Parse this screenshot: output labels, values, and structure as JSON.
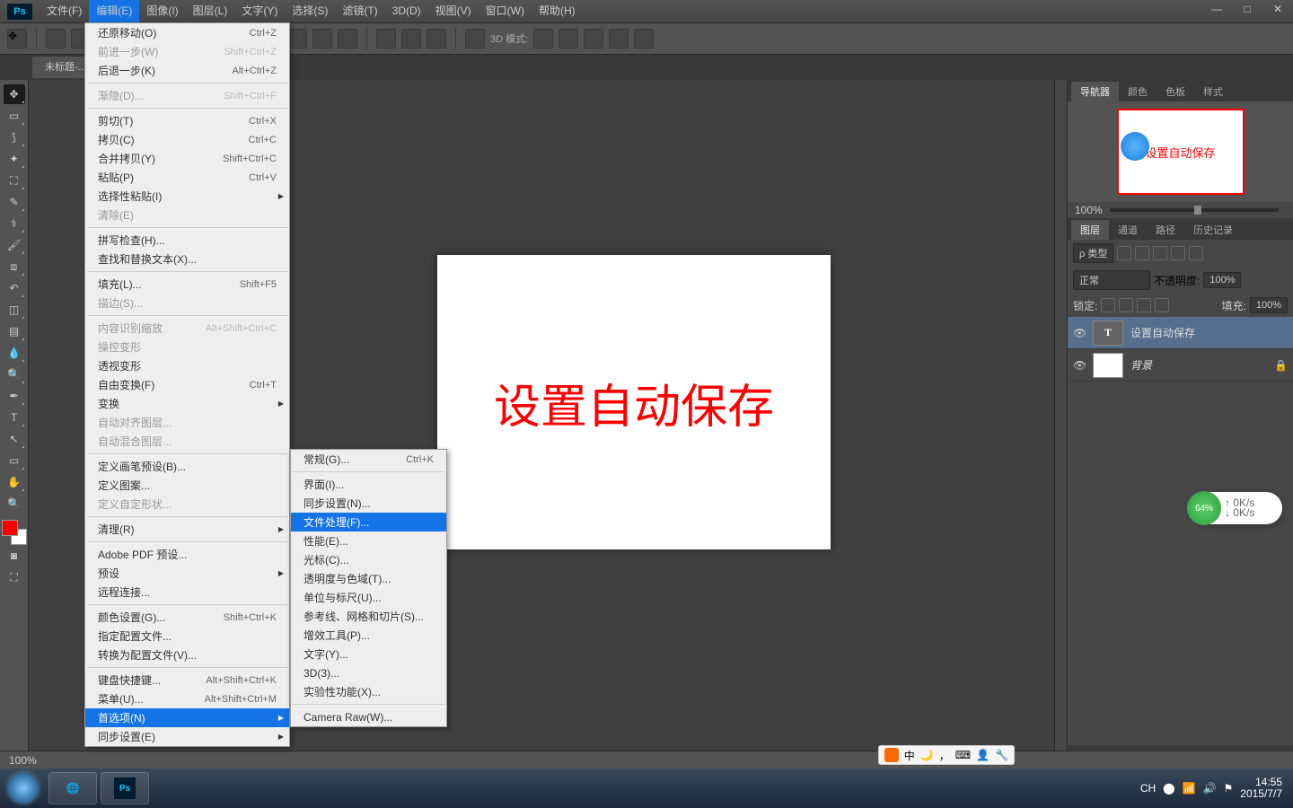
{
  "app": {
    "logo": "Ps"
  },
  "menubar": [
    "文件(F)",
    "编辑(E)",
    "图像(I)",
    "图层(L)",
    "文字(Y)",
    "选择(S)",
    "滤镜(T)",
    "3D(D)",
    "视图(V)",
    "窗口(W)",
    "帮助(H)"
  ],
  "doc_tab": "未标题-...",
  "opt_3d": "3D 模式:",
  "edit_menu": [
    {
      "label": "还原移动(O)",
      "sc": "Ctrl+Z"
    },
    {
      "label": "前进一步(W)",
      "sc": "Shift+Ctrl+Z",
      "disabled": true
    },
    {
      "label": "后退一步(K)",
      "sc": "Alt+Ctrl+Z"
    },
    {
      "sep": true
    },
    {
      "label": "渐隐(D)...",
      "sc": "Shift+Ctrl+F",
      "disabled": true
    },
    {
      "sep": true
    },
    {
      "label": "剪切(T)",
      "sc": "Ctrl+X"
    },
    {
      "label": "拷贝(C)",
      "sc": "Ctrl+C"
    },
    {
      "label": "合并拷贝(Y)",
      "sc": "Shift+Ctrl+C"
    },
    {
      "label": "粘贴(P)",
      "sc": "Ctrl+V"
    },
    {
      "label": "选择性粘贴(I)",
      "sub": true
    },
    {
      "label": "清除(E)",
      "disabled": true
    },
    {
      "sep": true
    },
    {
      "label": "拼写检查(H)..."
    },
    {
      "label": "查找和替换文本(X)..."
    },
    {
      "sep": true
    },
    {
      "label": "填充(L)...",
      "sc": "Shift+F5"
    },
    {
      "label": "描边(S)...",
      "disabled": true
    },
    {
      "sep": true
    },
    {
      "label": "内容识别缩放",
      "sc": "Alt+Shift+Ctrl+C",
      "disabled": true
    },
    {
      "label": "操控变形",
      "disabled": true
    },
    {
      "label": "透视变形"
    },
    {
      "label": "自由变换(F)",
      "sc": "Ctrl+T"
    },
    {
      "label": "变换",
      "sub": true
    },
    {
      "label": "自动对齐图层...",
      "disabled": true
    },
    {
      "label": "自动混合图层...",
      "disabled": true
    },
    {
      "sep": true
    },
    {
      "label": "定义画笔预设(B)..."
    },
    {
      "label": "定义图案..."
    },
    {
      "label": "定义自定形状...",
      "disabled": true
    },
    {
      "sep": true
    },
    {
      "label": "清理(R)",
      "sub": true
    },
    {
      "sep": true
    },
    {
      "label": "Adobe PDF 预设..."
    },
    {
      "label": "预设",
      "sub": true
    },
    {
      "label": "远程连接..."
    },
    {
      "sep": true
    },
    {
      "label": "颜色设置(G)...",
      "sc": "Shift+Ctrl+K"
    },
    {
      "label": "指定配置文件..."
    },
    {
      "label": "转换为配置文件(V)..."
    },
    {
      "sep": true
    },
    {
      "label": "键盘快捷键...",
      "sc": "Alt+Shift+Ctrl+K"
    },
    {
      "label": "菜单(U)...",
      "sc": "Alt+Shift+Ctrl+M"
    },
    {
      "label": "首选项(N)",
      "sub": true,
      "hi": true
    },
    {
      "label": "同步设置(E)",
      "sub": true
    }
  ],
  "pref_menu": [
    {
      "label": "常规(G)...",
      "sc": "Ctrl+K"
    },
    {
      "sep": true
    },
    {
      "label": "界面(I)..."
    },
    {
      "label": "同步设置(N)..."
    },
    {
      "label": "文件处理(F)...",
      "hi": true
    },
    {
      "label": "性能(E)..."
    },
    {
      "label": "光标(C)..."
    },
    {
      "label": "透明度与色域(T)..."
    },
    {
      "label": "单位与标尺(U)..."
    },
    {
      "label": "参考线、网格和切片(S)..."
    },
    {
      "label": "增效工具(P)..."
    },
    {
      "label": "文字(Y)..."
    },
    {
      "label": "3D(3)..."
    },
    {
      "label": "实验性功能(X)..."
    },
    {
      "sep": true
    },
    {
      "label": "Camera Raw(W)..."
    }
  ],
  "canvas_text": "设置自动保存",
  "nav": {
    "tabs": [
      "导航器",
      "颜色",
      "色板",
      "样式"
    ],
    "zoom": "100%",
    "thumb_text": "设置自动保存"
  },
  "layers": {
    "tabs": [
      "图层",
      "通道",
      "路径",
      "历史记录"
    ],
    "kind": "ρ 类型",
    "blend": "正常",
    "opacity_label": "不透明度:",
    "opacity": "100%",
    "lock_label": "锁定:",
    "fill_label": "填充:",
    "fill": "100%",
    "rows": [
      {
        "name": "设置自动保存",
        "type": "T",
        "sel": true
      },
      {
        "name": "背景",
        "type": "bg",
        "locked": true
      }
    ]
  },
  "status_zoom": "100%",
  "float": {
    "pct": "64%",
    "r": "0K/s"
  },
  "ime": {
    "lang": "中"
  },
  "tray": {
    "ch": "CH",
    "time": "14:55",
    "date": "2015/7/7"
  }
}
